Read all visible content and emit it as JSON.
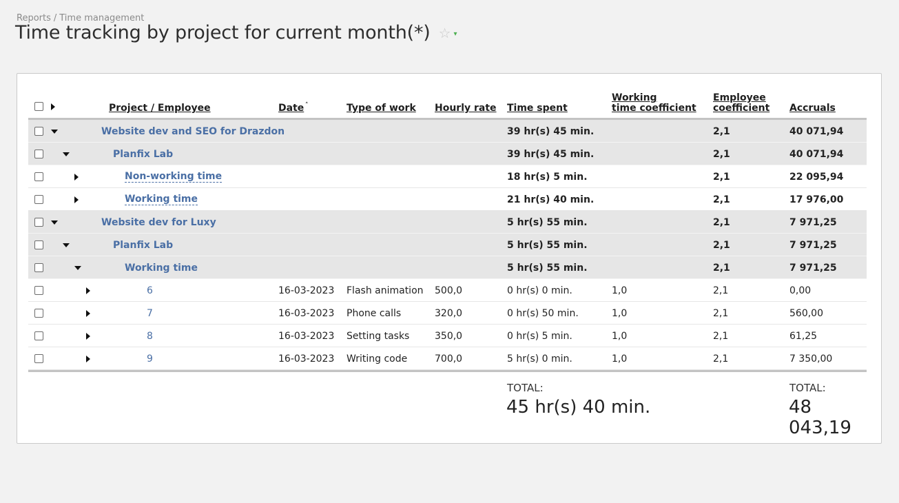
{
  "breadcrumb": {
    "parent": "Reports",
    "separator": "/",
    "current": "Time management"
  },
  "page": {
    "title": "Time tracking by project for current month(*)"
  },
  "icons": {
    "star": "star-outline-icon",
    "expand": "triangle-right-icon",
    "collapse": "triangle-down-icon"
  },
  "colors": {
    "link": "#4a6fa5",
    "group_row": "#e6e6e6",
    "background": "#f2f2f2"
  },
  "table": {
    "columns": {
      "project": "Project / Employee",
      "date": "Date",
      "date_sort": "˄",
      "type": "Type of work",
      "rate": "Hourly rate",
      "time": "Time spent",
      "wtc_line1": "Working",
      "wtc_line2": "time coefficient",
      "emp_line1": "Employee",
      "emp_line2": "coefficient",
      "accruals": "Accruals"
    },
    "rows": [
      {
        "kind": "grp",
        "toggle": "down",
        "level": 0,
        "label": "Website dev and SEO for Drazdon",
        "link": "lnk",
        "date": "",
        "type": "",
        "rate": "",
        "time": "39 hr(s) 45 min.",
        "wtc": "",
        "emp": "2,1",
        "accruals": "40 071,94"
      },
      {
        "kind": "grp",
        "toggle": "down",
        "level": 1,
        "label": "Planfix Lab",
        "link": "lnk",
        "date": "",
        "type": "",
        "rate": "",
        "time": "39 hr(s) 45 min.",
        "wtc": "",
        "emp": "2,1",
        "accruals": "40 071,94"
      },
      {
        "kind": "sub",
        "toggle": "right",
        "level": 2,
        "label": "Non-working time",
        "link": "dlnk",
        "date": "",
        "type": "",
        "rate": "",
        "time": "18 hr(s) 5 min.",
        "wtc": "",
        "emp": "2,1",
        "accruals": "22 095,94"
      },
      {
        "kind": "sub",
        "toggle": "right",
        "level": 2,
        "label": "Working time",
        "link": "dlnk",
        "date": "",
        "type": "",
        "rate": "",
        "time": "21 hr(s) 40 min.",
        "wtc": "",
        "emp": "2,1",
        "accruals": "17 976,00"
      },
      {
        "kind": "grp",
        "toggle": "down",
        "level": 0,
        "label": "Website dev for Luxy",
        "link": "lnk",
        "date": "",
        "type": "",
        "rate": "",
        "time": "5 hr(s) 55 min.",
        "wtc": "",
        "emp": "2,1",
        "accruals": "7 971,25"
      },
      {
        "kind": "grp",
        "toggle": "down",
        "level": 1,
        "label": "Planfix Lab",
        "link": "lnk",
        "date": "",
        "type": "",
        "rate": "",
        "time": "5 hr(s) 55 min.",
        "wtc": "",
        "emp": "2,1",
        "accruals": "7 971,25"
      },
      {
        "kind": "grp",
        "toggle": "down",
        "level": 2,
        "label": "Working time",
        "link": "lnk",
        "date": "",
        "type": "",
        "rate": "",
        "time": "5 hr(s) 55 min.",
        "wtc": "",
        "emp": "2,1",
        "accruals": "7 971,25"
      },
      {
        "kind": "item",
        "toggle": "right",
        "level": 3,
        "label": "6",
        "link": "lnk",
        "date": "16-03-2023",
        "type": "Flash animation",
        "rate": "500,0",
        "time": "0 hr(s) 0 min.",
        "wtc": "1,0",
        "emp": "2,1",
        "accruals": "0,00"
      },
      {
        "kind": "item",
        "toggle": "right",
        "level": 3,
        "label": "7",
        "link": "lnk",
        "date": "16-03-2023",
        "type": "Phone calls",
        "rate": "320,0",
        "time": "0 hr(s) 50 min.",
        "wtc": "1,0",
        "emp": "2,1",
        "accruals": "560,00"
      },
      {
        "kind": "item",
        "toggle": "right",
        "level": 3,
        "label": "8",
        "link": "lnk",
        "date": "16-03-2023",
        "type": "Setting tasks",
        "rate": "350,0",
        "time": "0 hr(s) 5 min.",
        "wtc": "1,0",
        "emp": "2,1",
        "accruals": "61,25"
      },
      {
        "kind": "item",
        "toggle": "right",
        "level": 3,
        "label": "9",
        "link": "lnk",
        "date": "16-03-2023",
        "type": "Writing code",
        "rate": "700,0",
        "time": "5 hr(s) 0 min.",
        "wtc": "1,0",
        "emp": "2,1",
        "accruals": "7 350,00"
      }
    ],
    "totals": {
      "time_label": "TOTAL:",
      "time_value": "45 hr(s) 40 min.",
      "accruals_label": "TOTAL:",
      "accruals_value": "48 043,19"
    }
  }
}
